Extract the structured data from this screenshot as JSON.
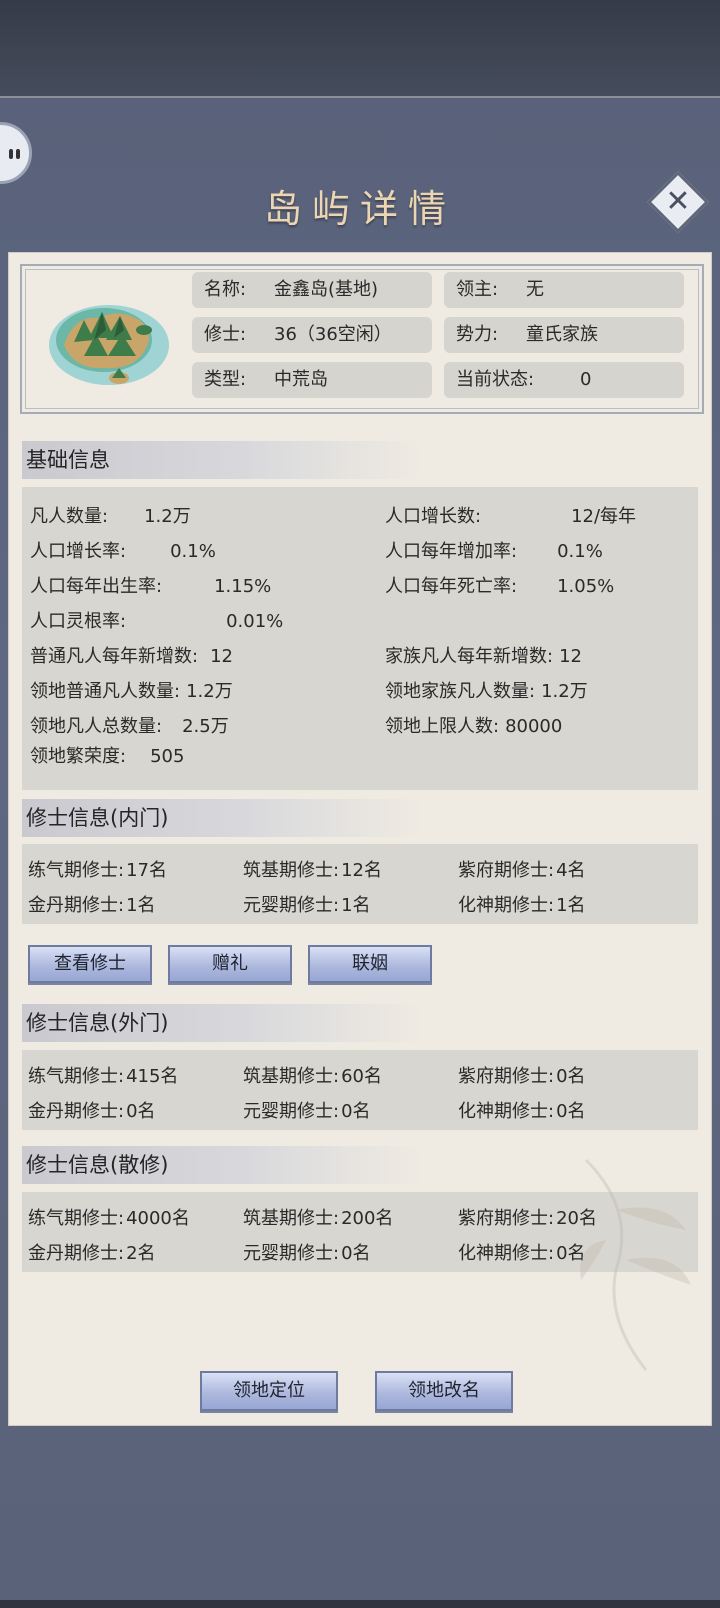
{
  "title": "岛屿详情",
  "island": {
    "name_label": "名称:",
    "name_value": "金鑫岛(基地)",
    "lord_label": "领主:",
    "lord_value": "无",
    "cultivators_label": "修士:",
    "cultivators_value": "36（36空闲）",
    "faction_label": "势力:",
    "faction_value": "童氏家族",
    "type_label": "类型:",
    "type_value": "中荒岛",
    "state_label": "当前状态:",
    "state_value": "0"
  },
  "basic": {
    "title": "基础信息",
    "items": [
      {
        "label": "凡人数量:",
        "value": "1.2万"
      },
      {
        "label": "人口增长数:",
        "value": "12/每年"
      },
      {
        "label": "人口增长率:",
        "value": "0.1%"
      },
      {
        "label": "人口每年增加率:",
        "value": "0.1%"
      },
      {
        "label": "人口每年出生率:",
        "value": "1.15%"
      },
      {
        "label": "人口每年死亡率:",
        "value": "1.05%"
      },
      {
        "label": "人口灵根率:",
        "value": "0.01%"
      },
      {
        "label": "普通凡人每年新增数:",
        "value": "12"
      },
      {
        "label": "家族凡人每年新增数:",
        "value": "12"
      },
      {
        "label": "领地普通凡人数量:",
        "value": "1.2万"
      },
      {
        "label": "领地家族凡人数量:",
        "value": "1.2万"
      },
      {
        "label": "领地凡人总数量:",
        "value": "2.5万"
      },
      {
        "label": "领地上限人数:",
        "value": "80000"
      },
      {
        "label": "领地繁荣度:",
        "value": "505"
      }
    ]
  },
  "inner": {
    "title": "修士信息(内门)",
    "items": [
      {
        "label": "练气期修士:",
        "value": "17名"
      },
      {
        "label": "筑基期修士:",
        "value": "12名"
      },
      {
        "label": "紫府期修士:",
        "value": "4名"
      },
      {
        "label": "金丹期修士:",
        "value": "1名"
      },
      {
        "label": "元婴期修士:",
        "value": "1名"
      },
      {
        "label": "化神期修士:",
        "value": "1名"
      }
    ],
    "buttons": [
      "查看修士",
      "赠礼",
      "联姻"
    ]
  },
  "outer": {
    "title": "修士信息(外门)",
    "items": [
      {
        "label": "练气期修士:",
        "value": "415名"
      },
      {
        "label": "筑基期修士:",
        "value": "60名"
      },
      {
        "label": "紫府期修士:",
        "value": "0名"
      },
      {
        "label": "金丹期修士:",
        "value": "0名"
      },
      {
        "label": "元婴期修士:",
        "value": "0名"
      },
      {
        "label": "化神期修士:",
        "value": "0名"
      }
    ]
  },
  "loose": {
    "title": "修士信息(散修)",
    "items": [
      {
        "label": "练气期修士:",
        "value": "4000名"
      },
      {
        "label": "筑基期修士:",
        "value": "200名"
      },
      {
        "label": "紫府期修士:",
        "value": "20名"
      },
      {
        "label": "金丹期修士:",
        "value": "2名"
      },
      {
        "label": "元婴期修士:",
        "value": "0名"
      },
      {
        "label": "化神期修士:",
        "value": "0名"
      }
    ]
  },
  "footer": {
    "locate_label": "领地定位",
    "rename_label": "领地改名"
  },
  "icons": {
    "chat": "chat-bubble-icon",
    "close": "close-icon",
    "island": "island-map-icon"
  }
}
